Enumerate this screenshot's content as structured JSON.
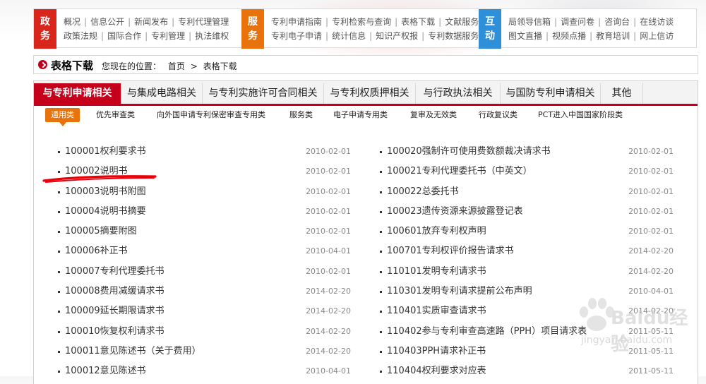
{
  "nav": {
    "groups": [
      {
        "tag_lines": [
          "政",
          "务"
        ],
        "color": "#d9261c",
        "rows": [
          [
            "概况",
            "信息公开",
            "新闻发布",
            "专利代理管理"
          ],
          [
            "政策法规",
            "国际合作",
            "专利管理",
            "执法维权"
          ]
        ]
      },
      {
        "tag_lines": [
          "服",
          "务"
        ],
        "color": "#e8730c",
        "rows": [
          [
            "专利申请指南",
            "专利检索与查询",
            "表格下载",
            "文献服务"
          ],
          [
            "专利电子申请",
            "统计信息",
            "知识产权报",
            "专利数据服务"
          ]
        ]
      },
      {
        "tag_lines": [
          "互",
          "动"
        ],
        "color": "#2f8fd8",
        "rows": [
          [
            "局领导信箱",
            "调查问卷",
            "咨询台",
            "在线访谈"
          ],
          [
            "图文直播",
            "视频点播",
            "教育培训",
            "网上信访"
          ]
        ]
      }
    ]
  },
  "breadcrumb": {
    "title": "表格下载",
    "location_label": "您现在的位置：",
    "home": "首页",
    "separator": ">",
    "current": "表格下载"
  },
  "tabs": [
    "与专利申请相关",
    "与集成电路相关",
    "与专利实施许可合同相关",
    "与专利权质押相关",
    "与行政执法相关",
    "与国防专利申请相关",
    "其他"
  ],
  "subtabs": [
    "通用类",
    "优先审查类",
    "向外国申请专利保密审查专用类",
    "服务类",
    "电子申请专用类",
    "复审及无效类",
    "行政复议类",
    "PCT进入中国国家阶段类"
  ],
  "left_items": [
    {
      "name": "100001权利要求书",
      "date": "2010-02-01"
    },
    {
      "name": "100002说明书",
      "date": "2010-02-01"
    },
    {
      "name": "100003说明书附图",
      "date": "2010-02-01"
    },
    {
      "name": "100004说明书摘要",
      "date": "2010-02-01"
    },
    {
      "name": "100005摘要附图",
      "date": "2010-02-01"
    },
    {
      "name": "100006补正书",
      "date": "2010-04-01"
    },
    {
      "name": "100007专利代理委托书",
      "date": "2010-02-01"
    },
    {
      "name": "100008费用减缓请求书",
      "date": "2014-02-20"
    },
    {
      "name": "100009延长期限请求书",
      "date": "2014-02-20"
    },
    {
      "name": "100010恢复权利请求书",
      "date": "2014-02-20"
    },
    {
      "name": "100011意见陈述书（关于费用）",
      "date": "2014-02-20"
    },
    {
      "name": "100012意见陈述书",
      "date": "2010-04-01"
    }
  ],
  "right_items": [
    {
      "name": "100020强制许可使用费数额裁决请求书",
      "date": "2010-02-01"
    },
    {
      "name": "100021专利代理委托书（中英文）",
      "date": "2010-02-01"
    },
    {
      "name": "100022总委托书",
      "date": "2010-02-01"
    },
    {
      "name": "100023遗传资源来源披露登记表",
      "date": "2010-02-01"
    },
    {
      "name": "100601放弃专利权声明",
      "date": "2010-02-01"
    },
    {
      "name": "100701专利权评价报告请求书",
      "date": "2014-02-20"
    },
    {
      "name": "110101发明专利请求书",
      "date": "2014-02-20"
    },
    {
      "name": "110301发明专利请求提前公布声明",
      "date": "2010-04-01"
    },
    {
      "name": "110401实质审查请求书",
      "date": "2014-02-20"
    },
    {
      "name": "110402参与专利审查高速路（PPH）项目请求表",
      "date": "2011-05-11"
    },
    {
      "name": "110403PPH请求补正书",
      "date": "2011-05-11"
    },
    {
      "name": "110404权利要求对应表",
      "date": "2011-05-11"
    }
  ],
  "watermark": {
    "brand": "Baidu经验",
    "url": "jingyan.baidu.com"
  },
  "colors": {
    "accent_red": "#c4001a",
    "subtab_orange": "#e8730c",
    "annotation_red": "#e8000b"
  }
}
